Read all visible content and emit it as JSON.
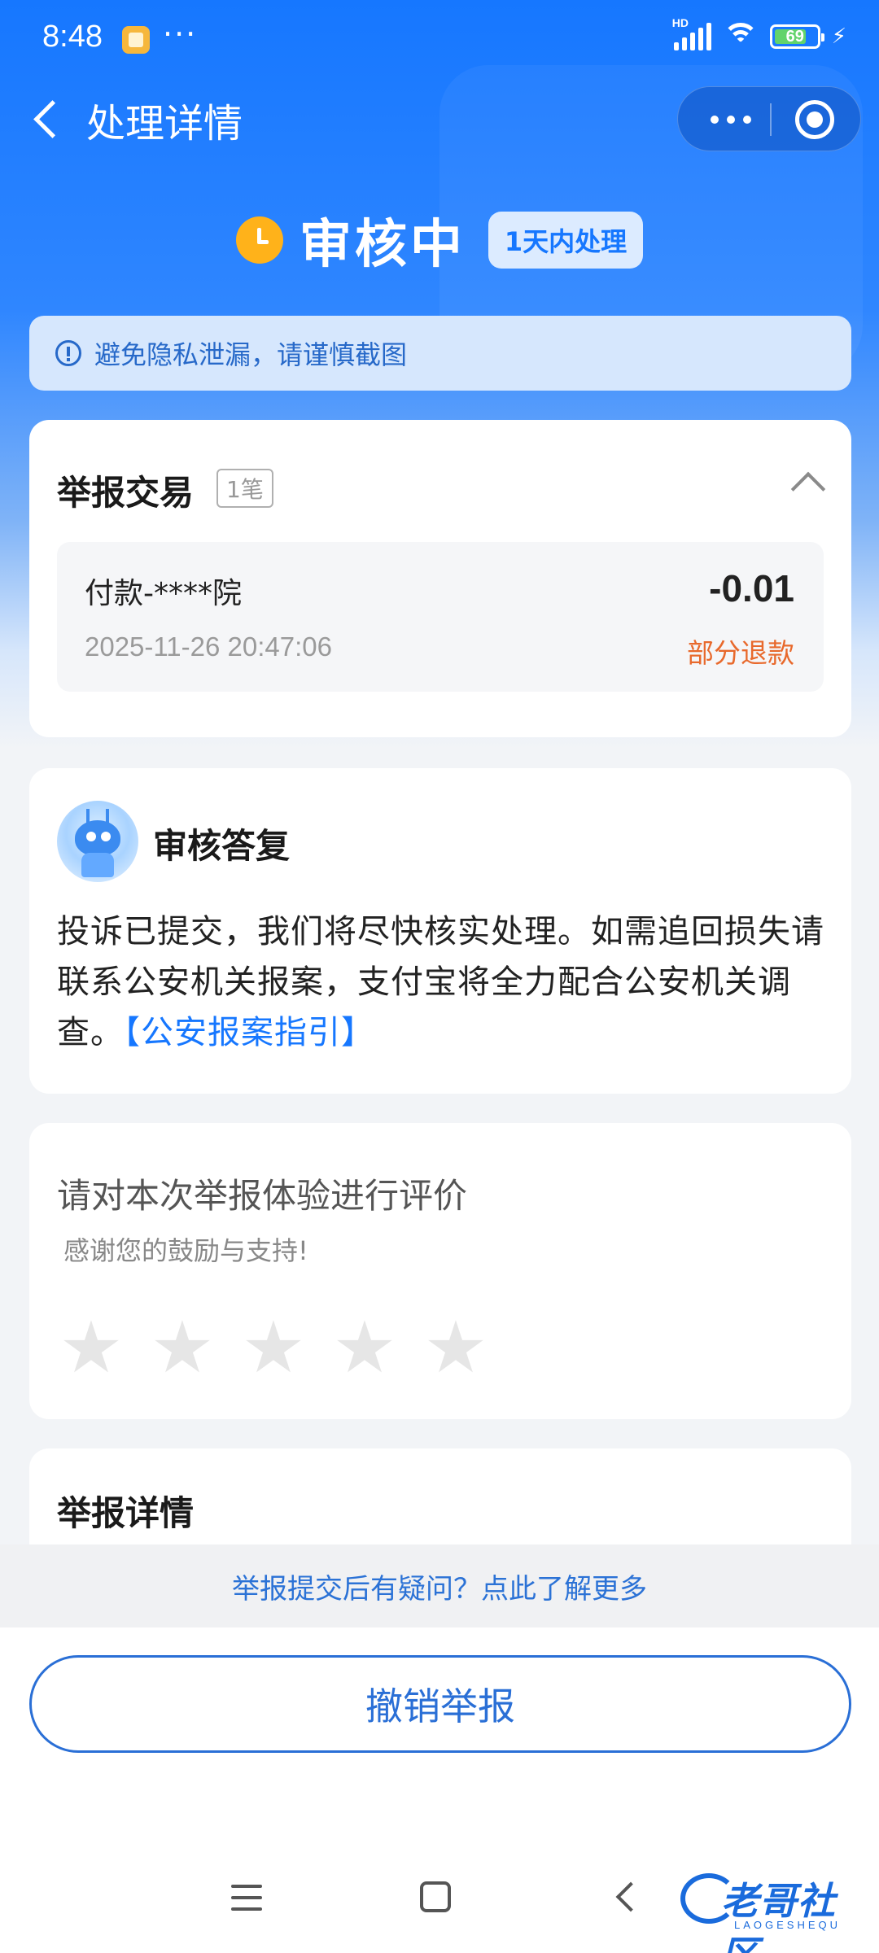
{
  "status_bar": {
    "time": "8:48",
    "dots": "···",
    "network": "HD",
    "battery": "69"
  },
  "nav": {
    "title": "处理详情"
  },
  "header": {
    "status": "审核中",
    "badge": "1天内处理"
  },
  "notice": {
    "text": "避免隐私泄漏，请谨慎截图"
  },
  "transaction_card": {
    "title": "举报交易",
    "count": "1笔",
    "item": {
      "name": "付款-****院",
      "amount": "-0.01",
      "time": "2025-11-26 20:47:06",
      "status": "部分退款"
    }
  },
  "reply_card": {
    "title": "审核答复",
    "text": "投诉已提交，我们将尽快核实处理。如需追回损失请联系公安机关报案，支付宝将全力配合公安机关调查。",
    "link": "【公安报案指引】"
  },
  "rating_card": {
    "title": "请对本次举报体验进行评价",
    "subtitle": "感谢您的鼓励与支持!",
    "stars_total": 5,
    "stars_selected": 0
  },
  "detail_card": {
    "title": "举报详情"
  },
  "help": {
    "text": "举报提交后有疑问？点此了解更多"
  },
  "actions": {
    "cancel_label": "撤销举报"
  },
  "watermark": {
    "text": "老哥社区",
    "sub": "LAOGESHEQU"
  },
  "colors": {
    "primary": "#1677ff",
    "warning": "#e8692c",
    "clock": "#ffb21a"
  }
}
